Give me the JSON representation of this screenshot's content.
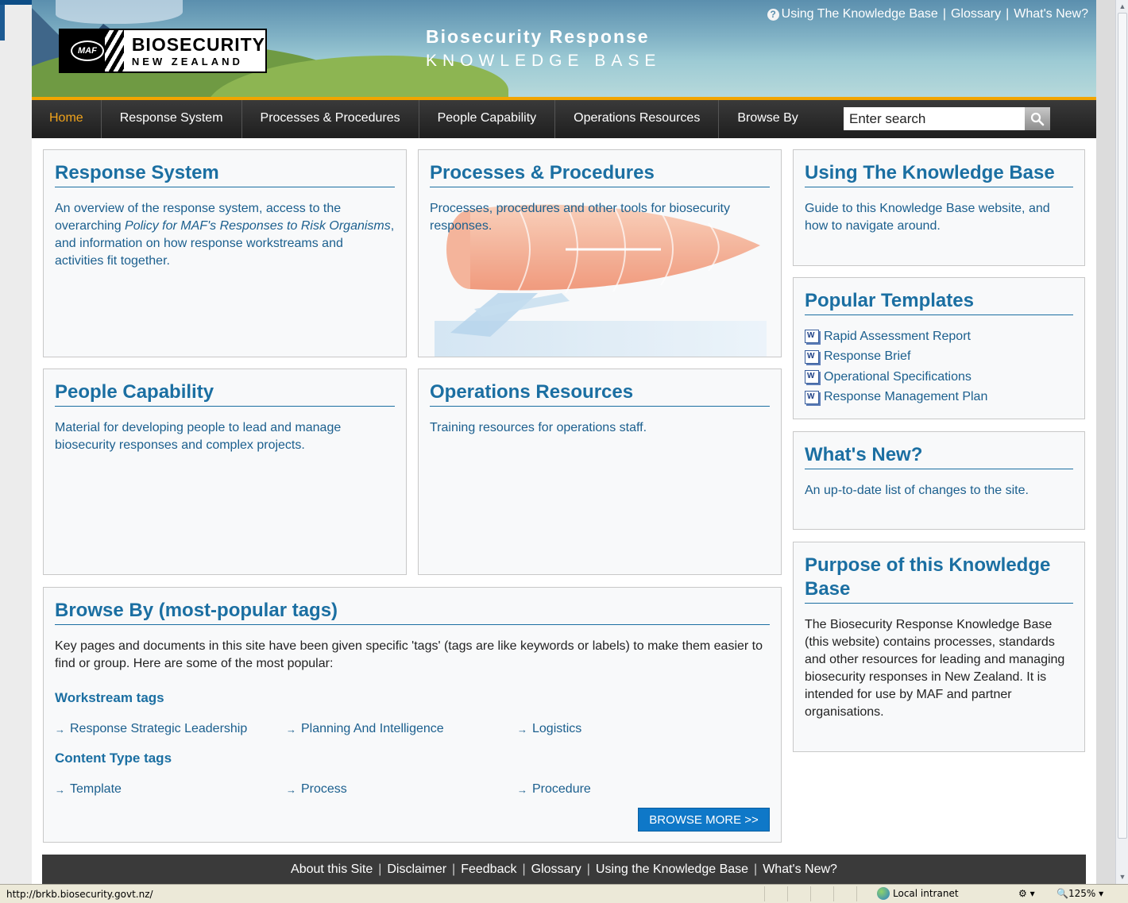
{
  "header": {
    "logo_main": "BIOSECURITY",
    "logo_sub": "NEW ZEALAND",
    "logo_badge": "MAF",
    "title_line1": "Biosecurity Response",
    "title_line2": "KNOWLEDGE BASE",
    "top_links": [
      "Using The Knowledge Base",
      "Glossary",
      "What's New?"
    ]
  },
  "nav": {
    "items": [
      "Home",
      "Response System",
      "Processes & Procedures",
      "People Capability",
      "Operations Resources",
      "Browse By"
    ],
    "active": "Home",
    "search_placeholder": "Enter search"
  },
  "boxes": {
    "response_system": {
      "title": "Response System",
      "text_a": "An overview of the response system, access to the overarching ",
      "text_em": "Policy for MAF's Responses to Risk Organisms",
      "text_b": ", and information on how response workstreams and activities fit together."
    },
    "processes": {
      "title": "Processes & Procedures",
      "text": "Processes, procedures and other tools for biosecurity responses."
    },
    "people": {
      "title": "People Capability",
      "text": "Material for developing people to lead and manage biosecurity responses and complex projects."
    },
    "operations": {
      "title": "Operations Resources",
      "text": "Training resources for operations staff."
    },
    "using_kb": {
      "title": "Using The Knowledge Base",
      "text": "Guide to this Knowledge Base website, and how to navigate around."
    },
    "templates": {
      "title": "Popular Templates",
      "items": [
        "Rapid Assessment Report",
        "Response Brief",
        "Operational Specifications",
        "Response Management Plan"
      ]
    },
    "whats_new": {
      "title": "What's New?",
      "text": "An up-to-date list of changes to the site."
    },
    "purpose": {
      "title": "Purpose of this Knowledge Base",
      "text": "The Biosecurity Response Knowledge Base (this website) contains processes, standards and other resources for leading and managing biosecurity responses in New Zealand. It is intended for use by MAF and partner organisations."
    },
    "browse": {
      "title": "Browse By (most-popular tags)",
      "text": "Key pages and documents in this site have been given specific 'tags' (tags are like keywords or labels) to make them easier to find or group. Here are some of the most popular:",
      "workstream_heading": "Workstream tags",
      "workstream_tags": [
        "Response Strategic Leadership",
        "Planning And Intelligence",
        "Logistics"
      ],
      "content_heading": "Content Type tags",
      "content_tags": [
        "Template",
        "Process",
        "Procedure"
      ],
      "browse_more": "BROWSE MORE >>"
    }
  },
  "footer": {
    "links": [
      "About this Site",
      "Disclaimer",
      "Feedback",
      "Glossary",
      "Using the Knowledge Base",
      "What's New?"
    ]
  },
  "statusbar": {
    "url": "http://brkb.biosecurity.govt.nz/",
    "zone": "Local intranet",
    "zoom": "125%"
  },
  "colors": {
    "accent": "#1b6fa2",
    "nav_active": "#f0a31b",
    "button": "#0f78c8",
    "header_gold": "#f2a500"
  }
}
